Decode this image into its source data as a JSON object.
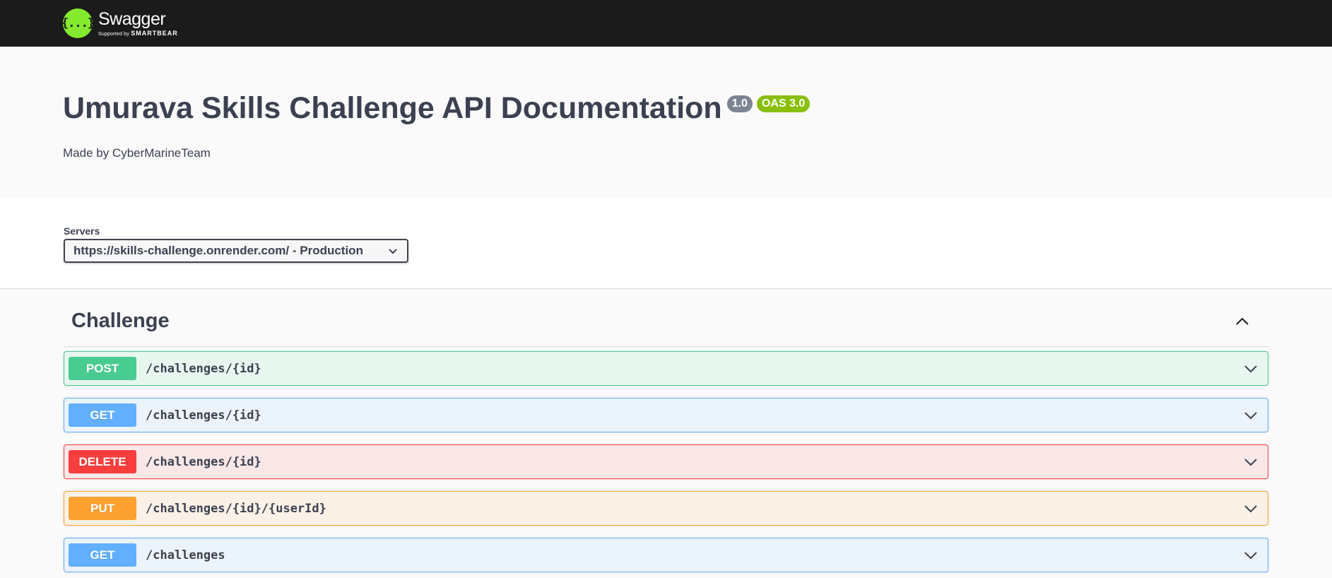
{
  "topbar": {
    "logo_glyph": "{...}",
    "brand": "Swagger",
    "supported_by": "Supported by",
    "smartbear": "SMARTBEAR"
  },
  "info": {
    "title": "Umurava Skills Challenge API Documentation",
    "version": "1.0",
    "oas": "OAS 3.0",
    "description": "Made by CyberMarineTeam"
  },
  "servers": {
    "label": "Servers",
    "selected": "https://skills-challenge.onrender.com/ - Production"
  },
  "tag": {
    "name": "Challenge",
    "toggle_icon": "chevron-up-icon"
  },
  "operations": [
    {
      "method": "POST",
      "path": "/challenges/{id}"
    },
    {
      "method": "GET",
      "path": "/challenges/{id}"
    },
    {
      "method": "DELETE",
      "path": "/challenges/{id}"
    },
    {
      "method": "PUT",
      "path": "/challenges/{id}/{userId}"
    },
    {
      "method": "GET",
      "path": "/challenges"
    }
  ],
  "colors": {
    "post": "#49cc90",
    "get": "#61affe",
    "delete": "#f93e3e",
    "put": "#fca130",
    "logo": "#85ea2d",
    "oas_badge": "#89bf04",
    "version_badge": "#7d8492"
  }
}
